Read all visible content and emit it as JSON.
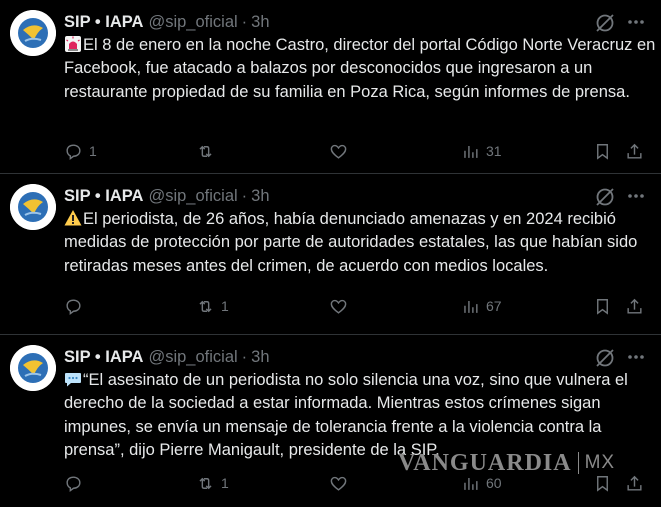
{
  "tweets": [
    {
      "name": "SIP • IAPA",
      "handle": "@sip_oficial",
      "separator": "·",
      "time": "3h",
      "emoji_icon": "rotating-light-icon",
      "text": "El 8 de enero en la noche Castro, director del portal Código Norte Veracruz en Facebook, fue atacado a balazos por desconocidos que ingresaron a un restaurante propiedad de su familia en Poza Rica, según informes de prensa.",
      "replies": "1",
      "reposts": "",
      "likes": "",
      "views": "31"
    },
    {
      "name": "SIP • IAPA",
      "handle": "@sip_oficial",
      "separator": "·",
      "time": "3h",
      "emoji_icon": "warning-icon",
      "text": "El periodista, de 26 años, había denunciado amenazas y en 2024 recibió medidas de protección por parte de autoridades estatales, las que habían sido retiradas meses antes del crimen, de acuerdo con medios locales.",
      "replies": "",
      "reposts": "1",
      "likes": "",
      "views": "67"
    },
    {
      "name": "SIP • IAPA",
      "handle": "@sip_oficial",
      "separator": "·",
      "time": "3h",
      "emoji_icon": "speech-balloon-icon",
      "text": "“El asesinato de un periodista no solo silencia una voz, sino que vulnera el derecho de la sociedad a estar informada. Mientras estos crímenes sigan impunes, se envía un mensaje de tolerancia frente a la violencia contra la prensa”, dijo Pierre Manigault, presidente de la SIP.",
      "replies": "",
      "reposts": "1",
      "likes": "",
      "views": "60"
    }
  ],
  "watermark": {
    "brand": "VANGUARDIA",
    "suffix": "MX"
  },
  "colors": {
    "background": "#000000",
    "text": "#e7e9ea",
    "muted": "#71767b",
    "divider": "#2f3336"
  }
}
